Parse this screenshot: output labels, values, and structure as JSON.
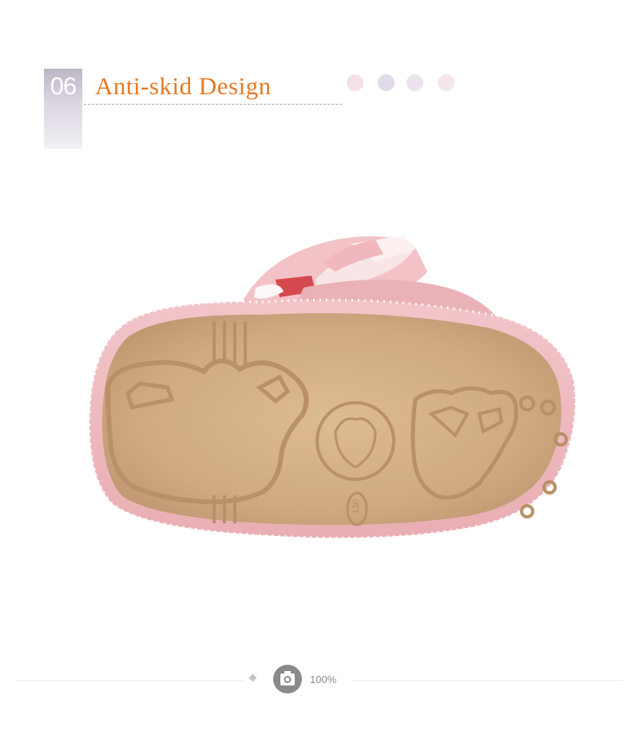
{
  "header": {
    "number": "06",
    "title": "Anti-skid Design",
    "dots": [
      "#f4e1ea",
      "#e1dbe9",
      "#ebe3ec",
      "#f5e6ee"
    ]
  },
  "photo": {
    "subject": "pink baby shoe sole",
    "sole_size_mark": "130"
  },
  "footer": {
    "zoom_label": "100%",
    "zoom_icon": "camera-icon",
    "marker_icon": "diamond-icon"
  }
}
